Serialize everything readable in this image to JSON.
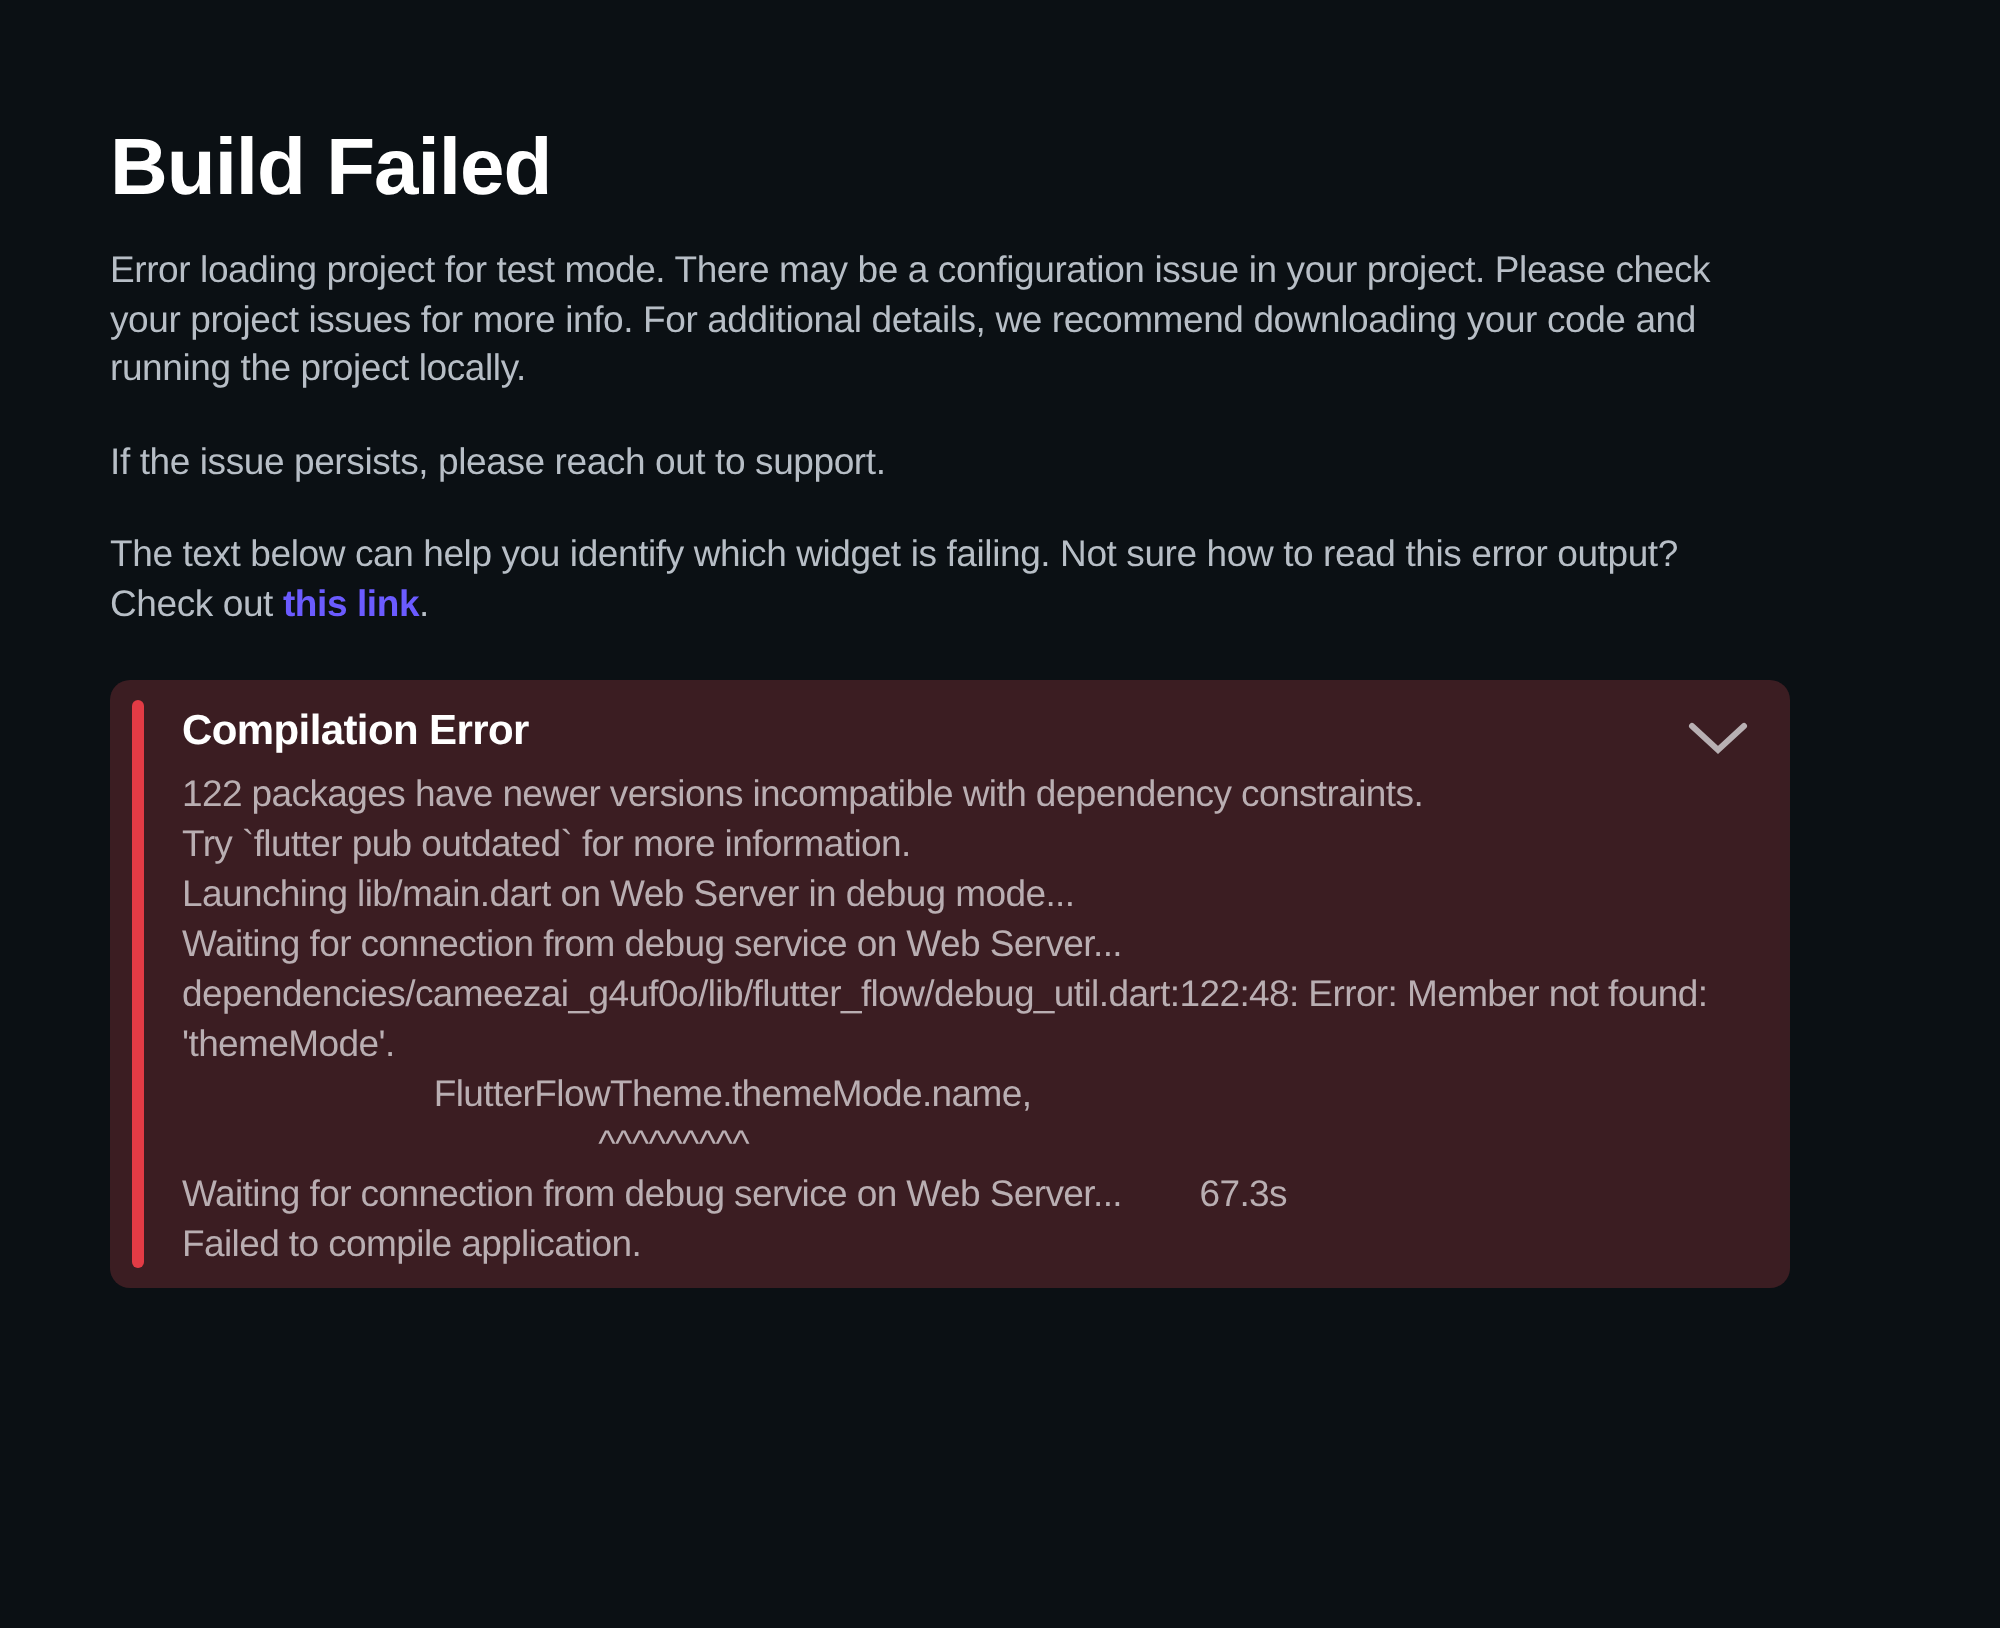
{
  "title": "Build Failed",
  "paragraphs": [
    {
      "text": "Error loading project for test mode. There may be a configuration issue in your project. Please check your project issues for more info. For additional details, we recommend downloading your code and running the project locally."
    },
    {
      "text": "If the issue persists, please reach out to support."
    },
    {
      "text": "The text below can help you identify which widget is failing. Not sure how to read this error output? Check out ",
      "link": "this link",
      "after": "."
    }
  ],
  "error_panel": {
    "title": "Compilation Error",
    "lines": [
      "122 packages have newer versions incompatible with dependency constraints.",
      "Try `flutter pub outdated` for more information.",
      "Launching lib/main.dart on Web Server in debug mode...",
      "Waiting for connection from debug service on Web Server...",
      "dependencies/cameezai_g4uf0o/lib/flutter_flow/debug_util.dart:122:48: Error: Member not found: 'themeMode'.",
      "                          FlutterFlowTheme.themeMode.name,",
      "                                           ^^^^^^^^^",
      "Waiting for connection from debug service on Web Server...        67.3s",
      "Failed to compile application."
    ]
  }
}
